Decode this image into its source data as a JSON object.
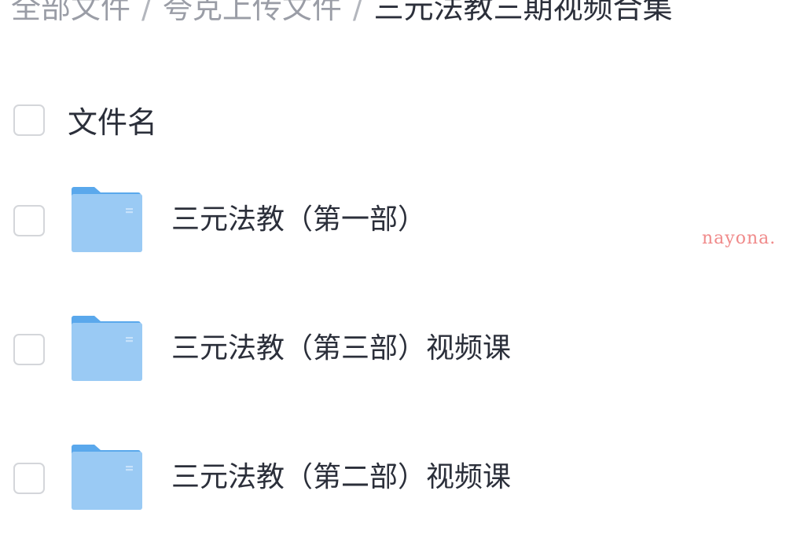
{
  "breadcrumb": {
    "items": [
      "全部文件",
      "夸克上传文件",
      "三元法教三期视频合集"
    ],
    "separator": "/"
  },
  "list_header": {
    "name_column": "文件名"
  },
  "files": [
    {
      "name": "三元法教（第一部）",
      "icon": "folder-icon"
    },
    {
      "name": "三元法教（第三部）视频课",
      "icon": "folder-icon"
    },
    {
      "name": "三元法教（第二部）视频课",
      "icon": "folder-icon"
    }
  ],
  "watermark": "nayona.",
  "colors": {
    "folder_front": "#8fc4f3",
    "folder_back": "#5aa8ec",
    "text_primary": "#2b2f3a",
    "text_muted": "#9a9da6",
    "checkbox_border": "#d4d6da",
    "watermark": "#f08a8a"
  }
}
